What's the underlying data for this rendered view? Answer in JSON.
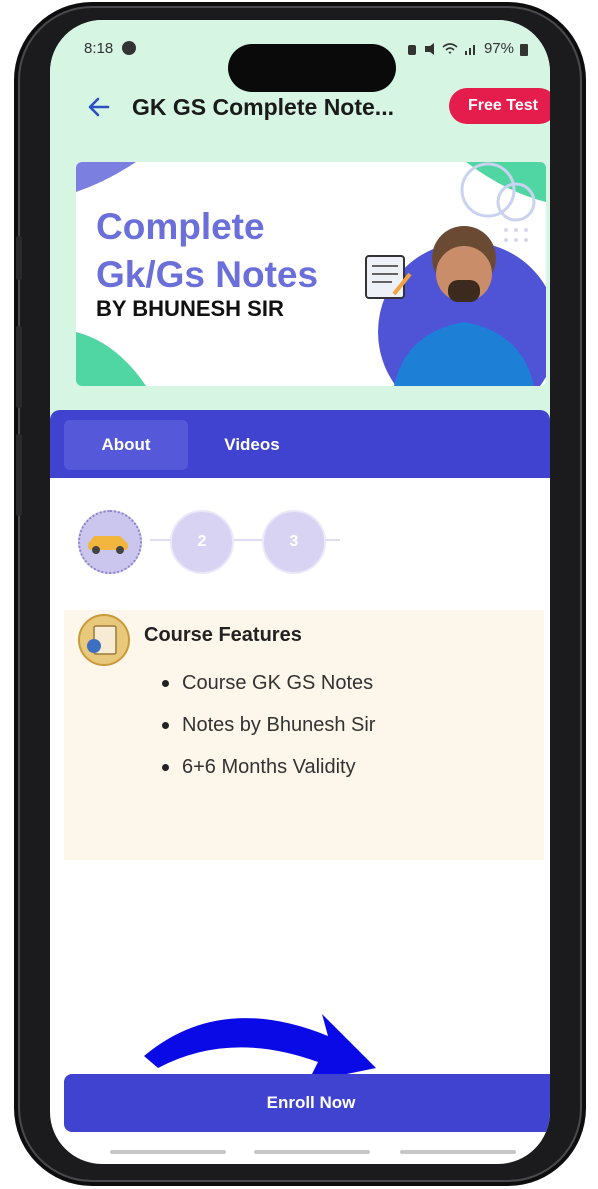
{
  "status": {
    "time": "8:18",
    "battery": "97%"
  },
  "appbar": {
    "title": "GK GS Complete Note...",
    "free_test_label": "Free Test"
  },
  "banner": {
    "line1": "Complete",
    "line2": "Gk/Gs Notes",
    "line3": "BY BHUNESH SIR"
  },
  "tabs": [
    {
      "label": "About"
    },
    {
      "label": "Videos"
    }
  ],
  "steps": [
    {
      "label": ""
    },
    {
      "label": "2"
    },
    {
      "label": "3"
    }
  ],
  "features": {
    "title": "Course Features",
    "items": [
      "Course GK GS Notes",
      "Notes by Bhunesh Sir",
      "6+6 Months Validity"
    ]
  },
  "enroll": {
    "label": "Enroll Now"
  },
  "colors": {
    "primary": "#3f43d0",
    "header_bg": "#d6f5e3",
    "badge": "#e51d4c",
    "features_bg": "#fdf6ea"
  }
}
